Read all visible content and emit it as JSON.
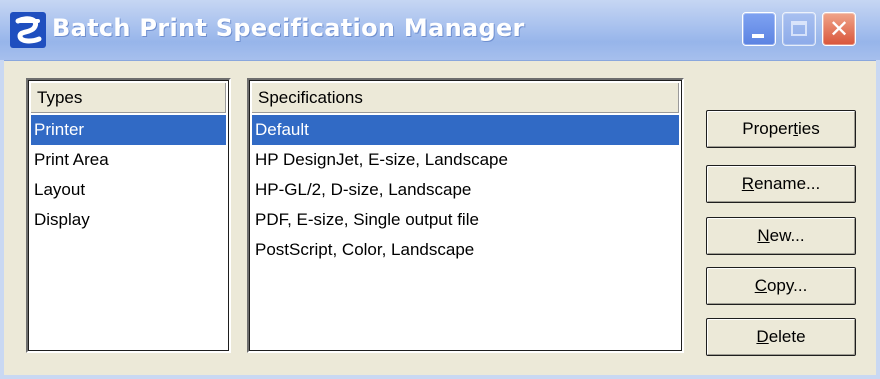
{
  "window": {
    "title": "Batch Print Specification Manager",
    "icon": "microstation-app-icon",
    "controls": {
      "minimize": "minimize-icon",
      "maximize": "maximize-icon",
      "close": "close-icon",
      "close_glyph": "✕"
    }
  },
  "types": {
    "header": "Types",
    "items": [
      "Printer",
      "Print Area",
      "Layout",
      "Display"
    ],
    "selected": "Printer"
  },
  "specifications": {
    "header": "Specifications",
    "items": [
      "Default",
      "HP DesignJet, E-size, Landscape",
      "HP-GL/2, D-size, Landscape",
      "PDF, E-size, Single output file",
      "PostScript, Color, Landscape"
    ],
    "selected": "Default"
  },
  "buttons": {
    "properties": {
      "pre": "Proper",
      "mn": "t",
      "post": "ies"
    },
    "rename": {
      "pre": "",
      "mn": "R",
      "post": "ename..."
    },
    "new": {
      "pre": "",
      "mn": "N",
      "post": "ew..."
    },
    "copy": {
      "pre": "",
      "mn": "C",
      "post": "opy..."
    },
    "delete": {
      "pre": "",
      "mn": "D",
      "post": "elete"
    }
  },
  "colors": {
    "selection": "#316ac5",
    "titlebar": "#a8c1ee",
    "window_bg": "#ece9d8",
    "close_button": "#d9553a"
  }
}
